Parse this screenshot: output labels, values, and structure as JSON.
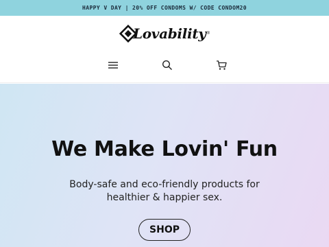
{
  "announcement": {
    "text": "HAPPY V DAY | 20% OFF CONDOMS W/ CODE CONDOM20",
    "background": "#8fd3de"
  },
  "header": {
    "logo": {
      "text": "Lovability",
      "registered": "®"
    },
    "icons": [
      "menu-icon",
      "search-icon",
      "cart-icon"
    ]
  },
  "hero": {
    "title": "We Make Lovin' Fun",
    "subtitle_line1": "Body-safe and eco-friendly products for",
    "subtitle_line2": "healthier & happier sex.",
    "cta_label": "SHOP",
    "gradient_colors": [
      "#cfe6f3",
      "#ead9f3"
    ]
  }
}
